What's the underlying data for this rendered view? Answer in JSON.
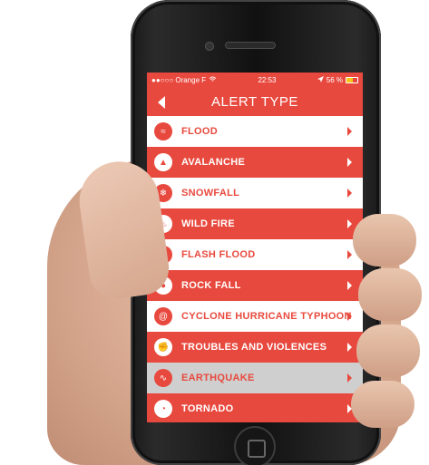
{
  "status_bar": {
    "carrier": "●●○○○ Orange F",
    "wifi_icon": "wifi-icon",
    "time": "22:53",
    "location_icon": "location-arrow-icon",
    "battery_text": "56 %",
    "battery_level": 0.56
  },
  "header": {
    "title": "ALERT TYPE"
  },
  "alerts": [
    {
      "label": "FLOOD",
      "icon": "flood-icon",
      "glyph": "≈"
    },
    {
      "label": "AVALANCHE",
      "icon": "avalanche-icon",
      "glyph": "▲"
    },
    {
      "label": "SNOWFALL",
      "icon": "snowfall-icon",
      "glyph": "❄"
    },
    {
      "label": "WILD FIRE",
      "icon": "wild-fire-icon",
      "glyph": "♨"
    },
    {
      "label": "FLASH FLOOD",
      "icon": "flash-flood-icon",
      "glyph": "≋"
    },
    {
      "label": "ROCK FALL",
      "icon": "rock-fall-icon",
      "glyph": "●"
    },
    {
      "label": "CYCLONE HURRICANE TYPHOON",
      "icon": "cyclone-icon",
      "glyph": "@"
    },
    {
      "label": "TROUBLES AND VIOLENCES",
      "icon": "fist-icon",
      "glyph": "✊"
    },
    {
      "label": "EARTHQUAKE",
      "icon": "earthquake-icon",
      "glyph": "∿"
    },
    {
      "label": "TORNADO",
      "icon": "tornado-icon",
      "glyph": "◔"
    }
  ],
  "colors": {
    "accent": "#e8493e",
    "row_light": "#ffffff",
    "row_selected": "#cfcfcf"
  }
}
